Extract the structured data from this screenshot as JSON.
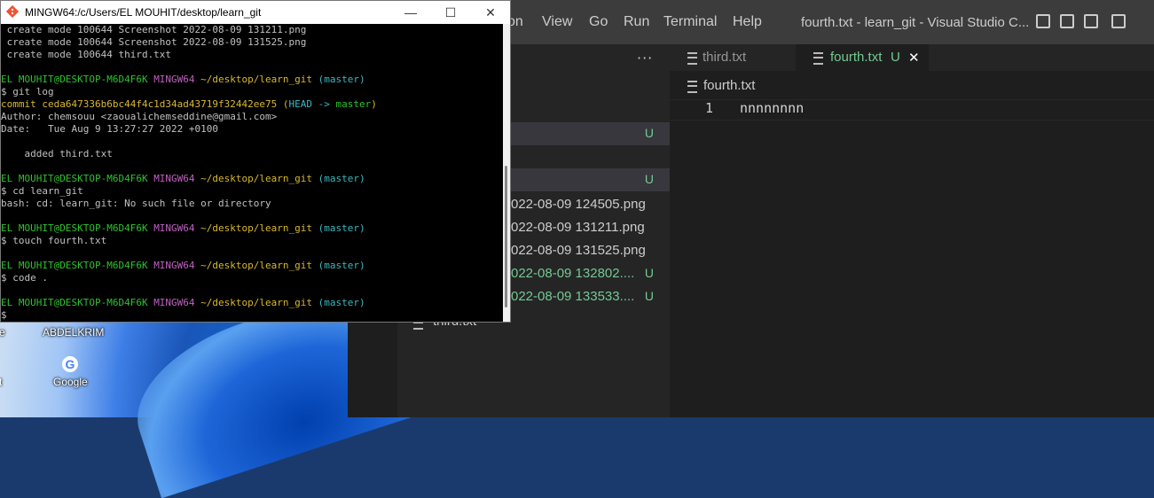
{
  "desktop": {
    "icons": [
      {
        "label": "e"
      },
      {
        "label": "ABDELKRIM"
      },
      {
        "label": "t"
      },
      {
        "label": "Google"
      }
    ]
  },
  "vscode": {
    "menu": [
      "on",
      "View",
      "Go",
      "Run",
      "Terminal",
      "Help"
    ],
    "window_title": "fourth.txt - learn_git - Visual Studio C...",
    "sidebar": {
      "more_label": "···",
      "rows": [
        {
          "label": "t",
          "badge": ""
        },
        {
          "label": "xt",
          "badge": "U"
        },
        {
          "label": "",
          "badge": "U"
        },
        {
          "label": "022-08-09 124505.png",
          "badge": ""
        },
        {
          "label": "022-08-09 131211.png",
          "badge": ""
        },
        {
          "label": "022-08-09 131525.png",
          "badge": ""
        },
        {
          "label": "022-08-09 132802....",
          "badge": "U"
        },
        {
          "label": "022-08-09 133533....",
          "badge": "U"
        },
        {
          "label": "third.txt",
          "badge": ""
        }
      ]
    },
    "tabs": [
      {
        "label": "third.txt"
      },
      {
        "label": "fourth.txt",
        "badge": "U",
        "close": "✕"
      }
    ],
    "breadcrumb": "fourth.txt",
    "editor": {
      "line_number": "1",
      "content": "nnnnnnnn"
    },
    "colors": {
      "untracked": "#73c991",
      "editor_bg": "#1e1e1e",
      "sidebar_bg": "#252526",
      "titlebar_bg": "#3c3c3c"
    }
  },
  "terminal": {
    "title": "MINGW64:/c/Users/EL MOUHIT/desktop/learn_git",
    "buttons": {
      "minimize": "—",
      "maximize": "☐",
      "close": "✕"
    },
    "lines": [
      [
        {
          "t": " create mode 100644 Screenshot 2022-08-09 131211.png",
          "c": "w"
        }
      ],
      [
        {
          "t": " create mode 100644 Screenshot 2022-08-09 131525.png",
          "c": "w"
        }
      ],
      [
        {
          "t": " create mode 100644 third.txt",
          "c": "w"
        }
      ],
      [
        {
          "t": "",
          "c": "w"
        }
      ],
      [
        {
          "t": "EL MOUHIT@DESKTOP-M6D4F6K ",
          "c": "g"
        },
        {
          "t": "MINGW64 ",
          "c": "m"
        },
        {
          "t": "~/desktop/learn_git ",
          "c": "y"
        },
        {
          "t": "(master)",
          "c": "c"
        }
      ],
      [
        {
          "t": "$ git log",
          "c": "w"
        }
      ],
      [
        {
          "t": "commit ceda647336b6bc44f4c1d34ad43719f32442ee75 ",
          "c": "y"
        },
        {
          "t": "(",
          "c": "y"
        },
        {
          "t": "HEAD -> ",
          "c": "c"
        },
        {
          "t": "master",
          "c": "g"
        },
        {
          "t": ")",
          "c": "y"
        }
      ],
      [
        {
          "t": "Author: chemsouu <zaoualichemseddine@gmail.com>",
          "c": "w"
        }
      ],
      [
        {
          "t": "Date:   Tue Aug 9 13:27:27 2022 +0100",
          "c": "w"
        }
      ],
      [
        {
          "t": "",
          "c": "w"
        }
      ],
      [
        {
          "t": "    added third.txt",
          "c": "w"
        }
      ],
      [
        {
          "t": "",
          "c": "w"
        }
      ],
      [
        {
          "t": "EL MOUHIT@DESKTOP-M6D4F6K ",
          "c": "g"
        },
        {
          "t": "MINGW64 ",
          "c": "m"
        },
        {
          "t": "~/desktop/learn_git ",
          "c": "y"
        },
        {
          "t": "(master)",
          "c": "c"
        }
      ],
      [
        {
          "t": "$ cd learn_git",
          "c": "w"
        }
      ],
      [
        {
          "t": "bash: cd: learn_git: No such file or directory",
          "c": "w"
        }
      ],
      [
        {
          "t": "",
          "c": "w"
        }
      ],
      [
        {
          "t": "EL MOUHIT@DESKTOP-M6D4F6K ",
          "c": "g"
        },
        {
          "t": "MINGW64 ",
          "c": "m"
        },
        {
          "t": "~/desktop/learn_git ",
          "c": "y"
        },
        {
          "t": "(master)",
          "c": "c"
        }
      ],
      [
        {
          "t": "$ touch fourth.txt",
          "c": "w"
        }
      ],
      [
        {
          "t": "",
          "c": "w"
        }
      ],
      [
        {
          "t": "EL MOUHIT@DESKTOP-M6D4F6K ",
          "c": "g"
        },
        {
          "t": "MINGW64 ",
          "c": "m"
        },
        {
          "t": "~/desktop/learn_git ",
          "c": "y"
        },
        {
          "t": "(master)",
          "c": "c"
        }
      ],
      [
        {
          "t": "$ code .",
          "c": "w"
        }
      ],
      [
        {
          "t": "",
          "c": "w"
        }
      ],
      [
        {
          "t": "EL MOUHIT@DESKTOP-M6D4F6K ",
          "c": "g"
        },
        {
          "t": "MINGW64 ",
          "c": "m"
        },
        {
          "t": "~/desktop/learn_git ",
          "c": "y"
        },
        {
          "t": "(master)",
          "c": "c"
        }
      ],
      [
        {
          "t": "$ ",
          "c": "w"
        }
      ]
    ]
  }
}
